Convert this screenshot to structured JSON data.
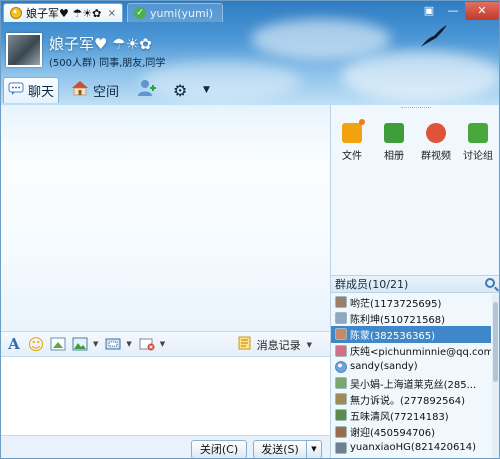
{
  "title_tabs": [
    {
      "label": "娘子军♥ ☂☀✿",
      "close": "×"
    },
    {
      "label": "yumi(yumi)"
    }
  ],
  "window_buttons": [
    "▣",
    "—",
    "✕"
  ],
  "group": {
    "name": "娘子军♥ ☂☀✿",
    "subtitle": "(500人群) 同事,朋友,同学"
  },
  "toolbar": {
    "chat_label": "聊天",
    "space_label": "空间",
    "dropdown": "▼"
  },
  "format_toolbar": {
    "font_icon": "A",
    "emoji_icon": "☺",
    "history_label": "消息记录",
    "caret": "▼"
  },
  "bottom": {
    "close_label": "关闭(C)",
    "send_label": "发送(S)",
    "send_drop": "▼"
  },
  "apps": [
    {
      "label": "文件",
      "icon": "folder-icon",
      "color": "#f2a20e"
    },
    {
      "label": "相册",
      "icon": "photo-icon",
      "color": "#3f9d3a"
    },
    {
      "label": "群视频",
      "icon": "video-icon",
      "color": "#e0533b"
    },
    {
      "label": "讨论组",
      "icon": "discussion-icon",
      "color": "#49a83b"
    }
  ],
  "members_header": "群成员(10/21)",
  "members": [
    {
      "name": "哟茫(1173725695)"
    },
    {
      "name": "陈利坤(510721568)"
    },
    {
      "name": "陈蒙(382536365)",
      "selected": true
    },
    {
      "name": "庆纯<pichunminnie@qq.com>"
    },
    {
      "name": "sandy(sandy)"
    },
    {
      "name": "吴小娟-上海道莱克丝(285..."
    },
    {
      "name": "無力诉说。(277892564)"
    },
    {
      "name": "五味清风(77214183)"
    },
    {
      "name": "谢迎(450594706)"
    },
    {
      "name": "yuanxiaoHG(821420614)"
    }
  ],
  "colors": {
    "accent": "#3f87c8",
    "sky_top": "#2f7cc2",
    "sky_bottom": "#bfe0f6"
  }
}
